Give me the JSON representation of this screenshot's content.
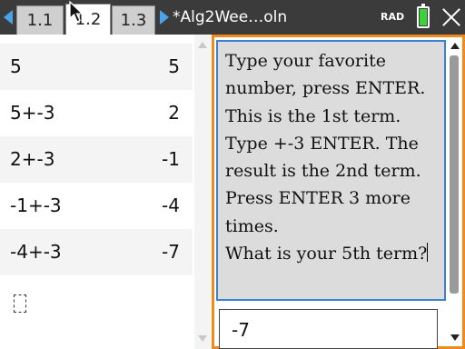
{
  "tabs": [
    {
      "label": "1.1",
      "active": false
    },
    {
      "label": "1.2",
      "active": true
    },
    {
      "label": "1.3",
      "active": false
    }
  ],
  "document_title": "*Alg2Wee…oln",
  "angle_mode": "RAD",
  "battery": {
    "level": 1.0,
    "color": "#3bd23b"
  },
  "calculator": {
    "history": [
      {
        "expression": "5",
        "result": "5"
      },
      {
        "expression": "5+-3",
        "result": "2"
      },
      {
        "expression": "2+-3",
        "result": "-1"
      },
      {
        "expression": "-1+-3",
        "result": "-4"
      },
      {
        "expression": "-4+-3",
        "result": "-7"
      }
    ]
  },
  "notes": {
    "lines": [
      "Type your favorite",
      "number, press ENTER.",
      "This is the 1st term.",
      "Type +-3 ENTER. The",
      "result is the 2nd term.",
      "Press ENTER 3 more",
      "times.",
      "What is your 5th term?"
    ],
    "answer": "-7"
  },
  "colors": {
    "topbar": "#3b3b3b",
    "nav_arrow": "#4aa3e8",
    "active_panel_border": "#f08a1c",
    "question_border": "#3a82d2"
  },
  "icons": {
    "nav_left": "triangle-left",
    "nav_right": "triangle-right",
    "close": "x",
    "battery": "battery-full"
  }
}
